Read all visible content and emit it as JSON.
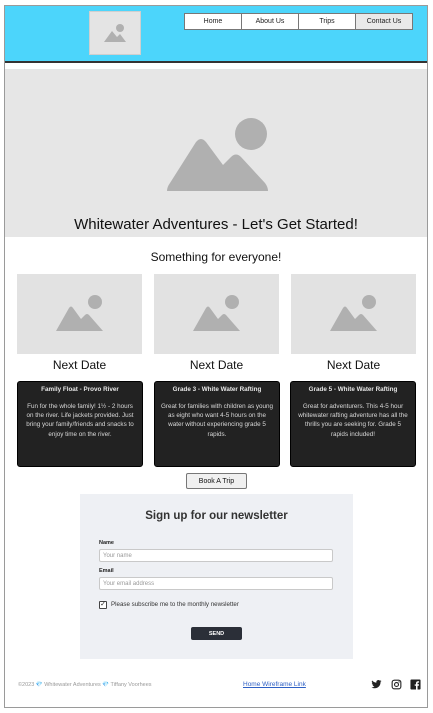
{
  "nav": {
    "items": [
      "Home",
      "About Us",
      "Trips",
      "Contact Us"
    ]
  },
  "hero": {
    "title": "Whitewater Adventures - Let's Get Started!"
  },
  "section": {
    "tagline": "Something for everyone!"
  },
  "cards": [
    {
      "next_label": "Next Date",
      "title": "Family Float - Provo River",
      "text": "Fun for the whole family! 1½ - 2 hours on the river. Life jackets provided. Just bring your family/friends and snacks to enjoy time on the river."
    },
    {
      "next_label": "Next Date",
      "title": "Grade 3 - White Water Rafting",
      "text": "Great for families with children as young as eight who want 4-5 hours on the water without experiencing grade 5 rapids."
    },
    {
      "next_label": "Next Date",
      "title": "Grade 5 - White Water Rafting",
      "text": "Great for adventurers.  This 4-5 hour whitewater rafting adventure has all the thrills you are seeking for.  Grade 5 rapids included!"
    }
  ],
  "book_button": "Book A Trip",
  "newsletter": {
    "title": "Sign up for our newsletter",
    "name_label": "Name",
    "name_placeholder": "Your name",
    "email_label": "Email",
    "email_placeholder": "Your email address",
    "consent_checked": true,
    "consent_label": "Please subscribe me to the monthly newsletter",
    "send_label": "SEND"
  },
  "footer": {
    "copyright": "©2023 💎 Whitewater Adventures 💎 Tiffany Voorhees",
    "link_text": "Home Wireframe Link",
    "social_icons": [
      "twitter-icon",
      "instagram-icon",
      "facebook-icon"
    ]
  },
  "colors": {
    "header_bg": "#4cd5fb",
    "card_bg": "#222222",
    "newsletter_bg": "#eef0f4",
    "send_button": "#2b2f38",
    "link": "#2d5fc4"
  }
}
